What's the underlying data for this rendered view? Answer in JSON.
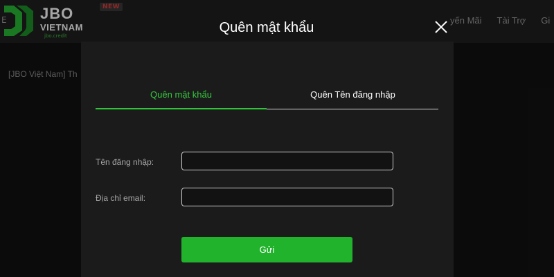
{
  "site": {
    "logo": {
      "brand": "JBO",
      "sub": "VIETNAM",
      "credit": "jbo.credit"
    },
    "new_badge": "NEW",
    "nav_left": "E",
    "nav_right": [
      "yến Mãi",
      "Tài Trợ",
      "Gi"
    ],
    "breadcrumb": "[JBO Việt Nam] Th"
  },
  "modal": {
    "title": "Quên mật khẩu",
    "tabs": [
      {
        "label": "Quên mật khẩu",
        "active": true
      },
      {
        "label": "Quên Tên đăng nhập",
        "active": false
      }
    ],
    "fields": [
      {
        "label": "Tên đăng nhập:",
        "value": "",
        "placeholder": ""
      },
      {
        "label": "Địa chỉ email:",
        "value": "",
        "placeholder": ""
      }
    ],
    "submit_label": "Gửi"
  },
  "colors": {
    "accent": "#2ec539",
    "button": "#20b32b",
    "background": "#121212",
    "modal_bg": "#1b1b1b",
    "badge_text": "#e23b3b"
  },
  "icons": [
    "logo-mark-icon",
    "close-icon"
  ]
}
